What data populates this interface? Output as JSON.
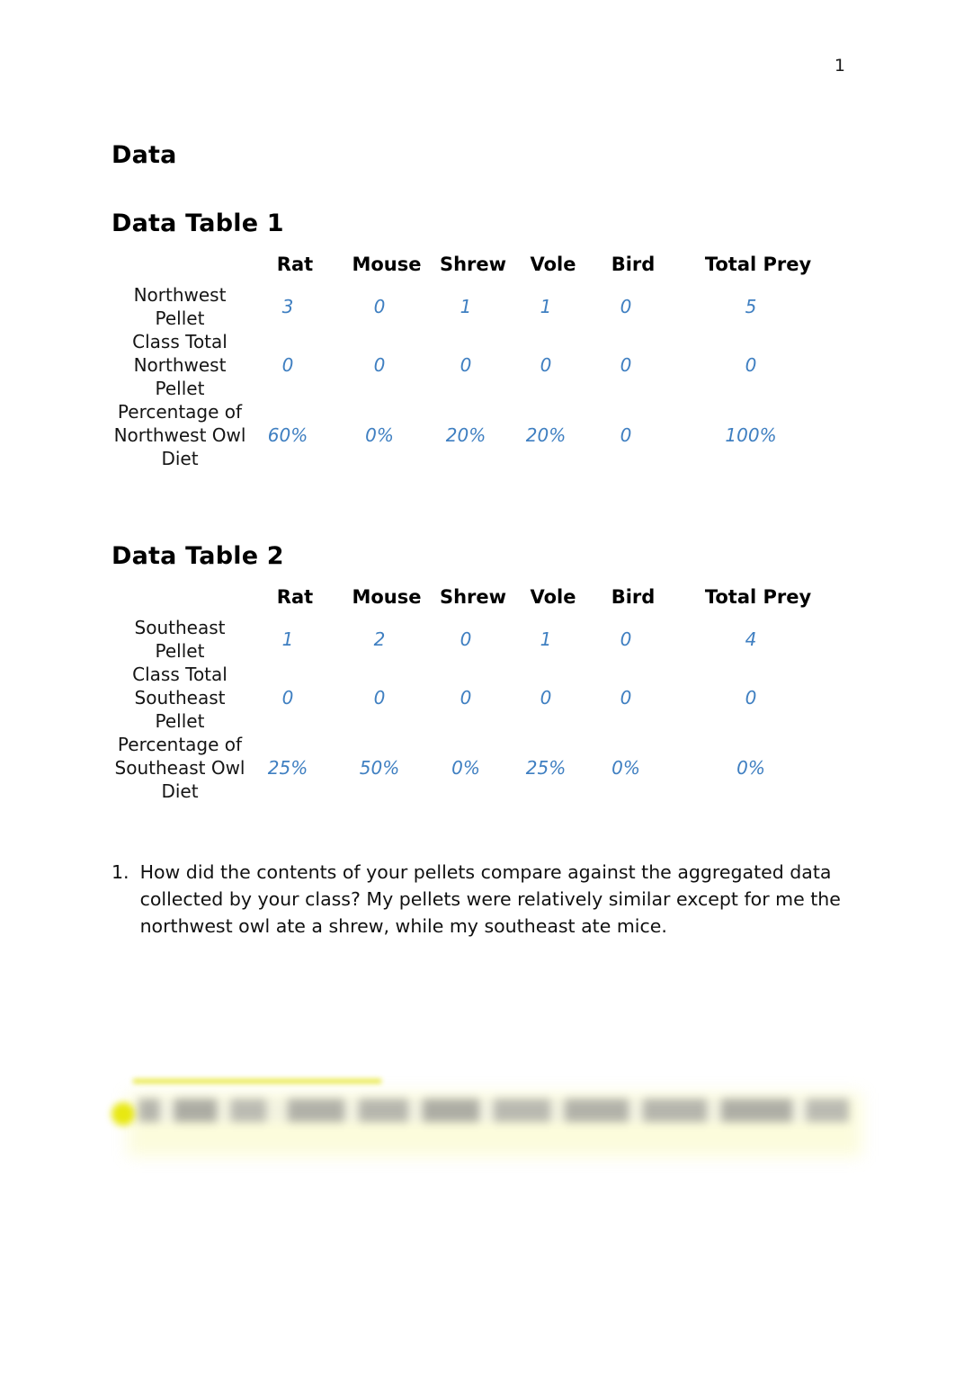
{
  "page": {
    "number": "1"
  },
  "headings": {
    "data": "Data",
    "table1": "Data Table 1",
    "table2": "Data Table 2"
  },
  "columns": [
    "",
    "Rat",
    "Mouse",
    "Shrew",
    "Vole",
    "Bird",
    "Total Prey"
  ],
  "table1": {
    "title": "Data Table 1",
    "headers": [
      "Rat",
      "Mouse",
      "Shrew",
      "Vole",
      "Bird",
      "Total Prey"
    ],
    "rows": [
      {
        "label": "Northwest Pellet",
        "values": [
          "3",
          "0",
          "1",
          "1",
          "0",
          "5"
        ]
      },
      {
        "label": "Class Total Northwest Pellet",
        "values": [
          "0",
          "0",
          "0",
          "0",
          "0",
          "0"
        ]
      },
      {
        "label": "Percentage of Northwest Owl Diet",
        "values": [
          "60%",
          "0%",
          "20%",
          "20%",
          "0",
          "100%"
        ]
      }
    ]
  },
  "table2": {
    "title": "Data Table 2",
    "headers": [
      "Rat",
      "Mouse",
      "Shrew",
      "Vole",
      "Bird",
      "Total Prey"
    ],
    "rows": [
      {
        "label": "Southeast Pellet",
        "values": [
          "1",
          "2",
          "0",
          "1",
          "0",
          "4"
        ]
      },
      {
        "label": "Class Total Southeast Pellet",
        "values": [
          "0",
          "0",
          "0",
          "0",
          "0",
          "0"
        ]
      },
      {
        "label": "Percentage of Southeast Owl Diet",
        "values": [
          "25%",
          "50%",
          "0%",
          "25%",
          "0%",
          "0%"
        ]
      }
    ]
  },
  "question": {
    "marker": "1.",
    "text": "How did the contents of your pellets compare against the aggregated data collected by your class? My pellets were relatively similar except for me the northwest owl ate a shrew, while my southeast ate mice."
  },
  "redacted": {
    "note": "",
    "highlight_color": "#e8e812"
  }
}
